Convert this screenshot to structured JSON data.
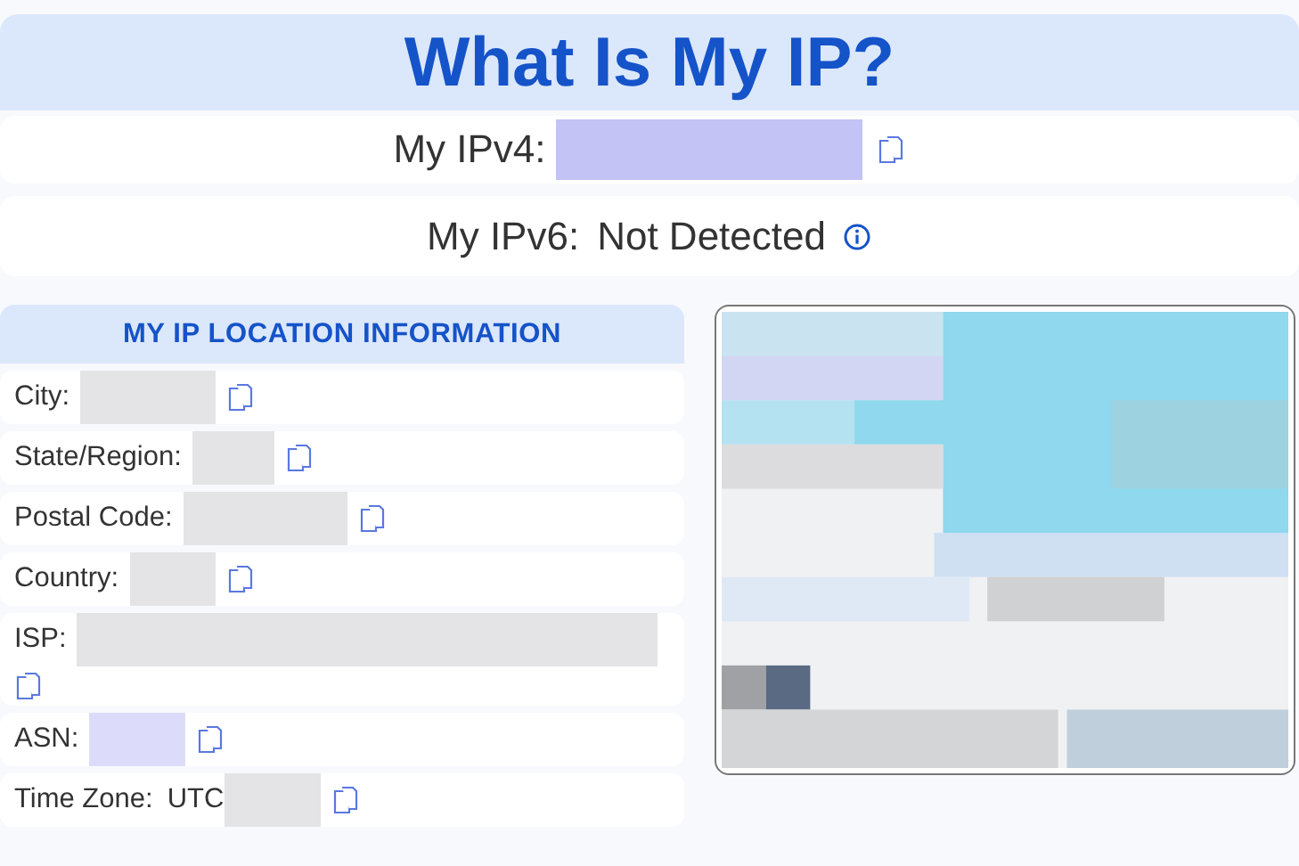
{
  "title": "What Is My IP?",
  "ip_rows": [
    {
      "kind": "copy",
      "label": "My IPv4:",
      "redacted": true,
      "color": "#c4c3f5"
    },
    {
      "kind": "info",
      "label": "My IPv6:",
      "value": "Not Detected"
    }
  ],
  "location": {
    "heading": "MY IP LOCATION INFORMATION",
    "rows": [
      {
        "label": "City:",
        "redacted": true,
        "color": "#e4e4e7"
      },
      {
        "label": "State/Region:",
        "redacted": true,
        "color": "#e4e4e7"
      },
      {
        "label": "Postal Code:",
        "redacted": true,
        "color": "#e4e4e7"
      },
      {
        "label": "Country:",
        "redacted": true,
        "color": "#e4e4e7"
      },
      {
        "label": "ISP:",
        "redacted": true,
        "color": "#e4e4e7"
      },
      {
        "label": "ASN:",
        "redacted": true,
        "color": "#dcdcfa"
      },
      {
        "label": "Time Zone:",
        "value": "UTC",
        "redacted": true,
        "color": "#e4e4e7"
      }
    ]
  }
}
